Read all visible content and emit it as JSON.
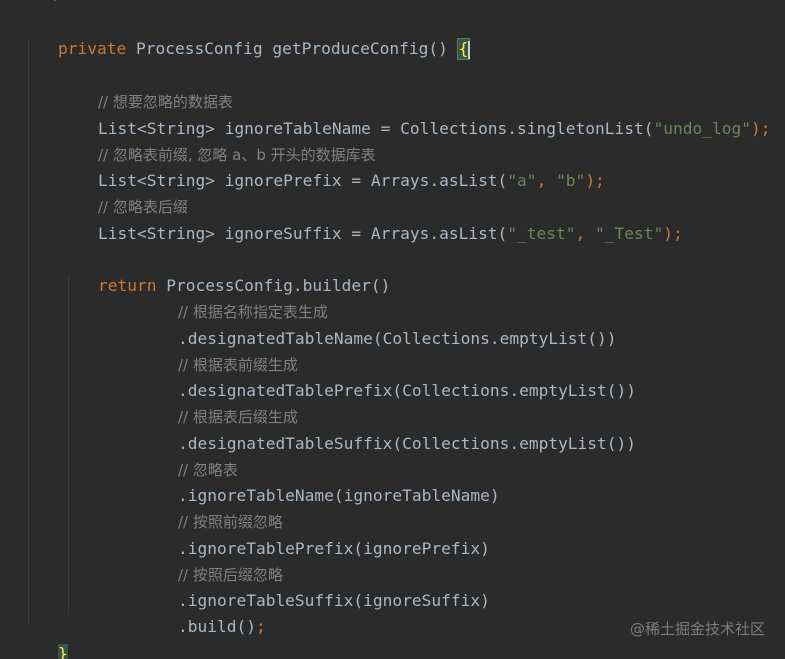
{
  "editor": {
    "top_fragment": "* */",
    "watermark": "@稀土掘金技术社区"
  },
  "code": {
    "l1": {
      "kw": "private",
      "rest": " ProcessConfig getProduceConfig() ",
      "brace": "{"
    },
    "l2": {
      "comment": "// 想要忽略的数据表"
    },
    "l3": {
      "pre": "List<String> ignoreTableName = Collections.singletonList(",
      "s1": "\"undo_log\"",
      "post": ");"
    },
    "l4": {
      "comment": "// 忽略表前缀, 忽略 a、b 开头的数据库表"
    },
    "l5": {
      "pre": "List<String> ignorePrefix = Arrays.asList(",
      "s1": "\"a\"",
      "mid": ", ",
      "s2": "\"b\"",
      "post": ");"
    },
    "l6": {
      "comment": "// 忽略表后缀"
    },
    "l7": {
      "pre": "List<String> ignoreSuffix = Arrays.asList(",
      "s1": "\"_test\"",
      "mid": ", ",
      "s2": "\"_Test\"",
      "post": ");"
    },
    "l8": {
      "kw": "return",
      "rest": " ProcessConfig.builder()"
    },
    "l9": {
      "comment": "// 根据名称指定表生成"
    },
    "l10": {
      "text": ".designatedTableName(Collections.emptyList())"
    },
    "l11": {
      "comment": "// 根据表前缀生成"
    },
    "l12": {
      "text": ".designatedTablePrefix(Collections.emptyList())"
    },
    "l13": {
      "comment": "// 根据表后缀生成"
    },
    "l14": {
      "text": ".designatedTableSuffix(Collections.emptyList())"
    },
    "l15": {
      "comment": "// 忽略表"
    },
    "l16": {
      "text": ".ignoreTableName(ignoreTableName)"
    },
    "l17": {
      "comment": "// 按照前缀忽略"
    },
    "l18": {
      "text": ".ignoreTablePrefix(ignorePrefix)"
    },
    "l19": {
      "comment": "// 按照后缀忽略"
    },
    "l20": {
      "text": ".ignoreTableSuffix(ignoreSuffix)"
    },
    "l21": {
      "text": ".build()",
      "semi": ";"
    },
    "l22": {
      "brace": "}"
    }
  },
  "colors": {
    "background": "#2b2b2b",
    "keyword": "#cc7832",
    "string": "#6a8759",
    "comment": "#808080",
    "text": "#a9b7c6",
    "brace_match": "#ffef28"
  }
}
